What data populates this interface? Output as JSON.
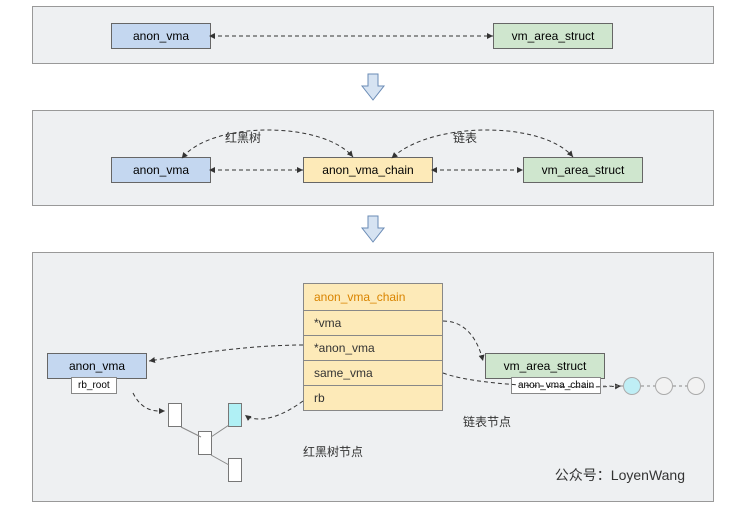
{
  "panel1": {
    "anon_vma": "anon_vma",
    "vm_area_struct": "vm_area_struct"
  },
  "panel2": {
    "anon_vma": "anon_vma",
    "anon_vma_chain": "anon_vma_chain",
    "vm_area_struct": "vm_area_struct",
    "label_rbtree": "红黑树",
    "label_list": "链表"
  },
  "panel3": {
    "anon_vma": "anon_vma",
    "rb_root": "rb_root",
    "vm_area_struct": "vm_area_struct",
    "anon_vma_chain_badge": "anon_vma_chain",
    "struct": {
      "title": "anon_vma_chain",
      "f1": "*vma",
      "f2": "*anon_vma",
      "f3": "same_vma",
      "f4": "rb"
    },
    "label_rb_node": "红黑树节点",
    "label_list_node": "链表节点",
    "credit": "公众号：LoyenWang"
  }
}
